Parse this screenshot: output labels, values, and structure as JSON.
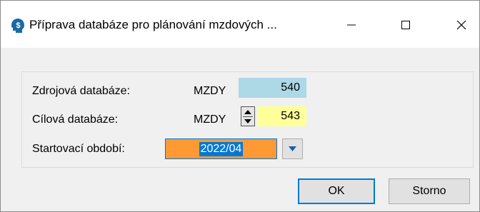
{
  "window": {
    "title": "Příprava databáze pro plánování mzdových ...",
    "icon": "dollar-head-icon",
    "controls": [
      "minimize-icon",
      "maximize-icon",
      "close-icon"
    ]
  },
  "form": {
    "source": {
      "label": "Zdrojová databáze:",
      "prefix": "MZDY",
      "value": "540",
      "bg_color": "#add8e6"
    },
    "target": {
      "label": "Cílová databáze:",
      "prefix": "MZDY",
      "value": "543",
      "bg_color": "#ffff99"
    },
    "start_period": {
      "label": "Startovací období:",
      "value": "2022/04",
      "bg_color": "#ff9933",
      "selection_color": "#0078d7"
    }
  },
  "buttons": {
    "ok": "OK",
    "cancel": "Storno"
  }
}
